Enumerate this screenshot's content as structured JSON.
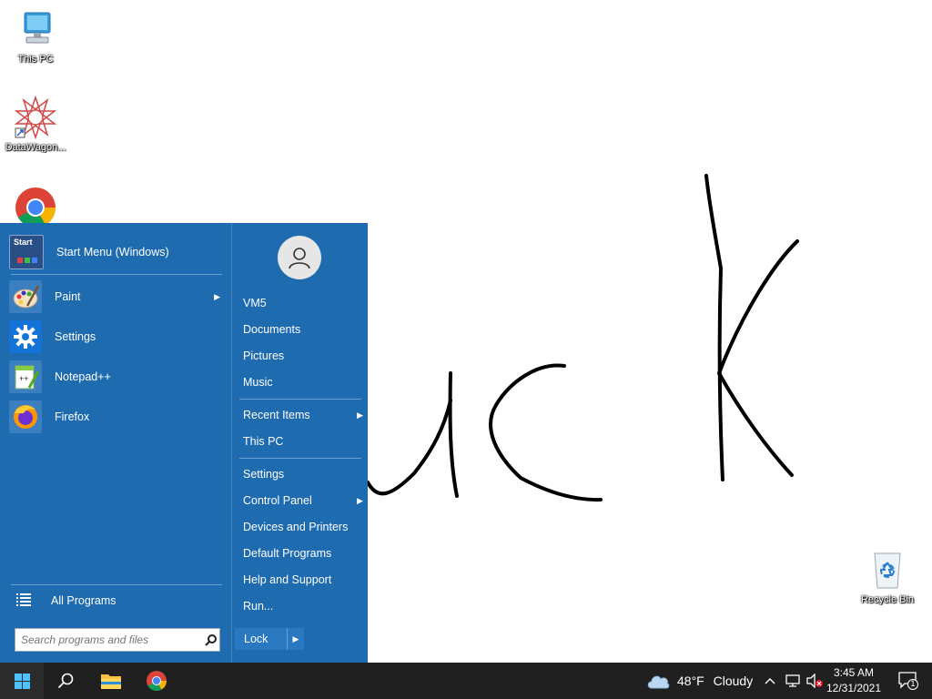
{
  "desktop": {
    "icons": [
      {
        "label": "This PC"
      },
      {
        "label": "DataWagon..."
      },
      {
        "label": ""
      },
      {
        "label": "Recycle Bin"
      }
    ]
  },
  "start_menu": {
    "header": {
      "label": "Start Menu (Windows)",
      "icon_text": "Start"
    },
    "programs": [
      {
        "label": "Paint",
        "has_submenu": true
      },
      {
        "label": "Settings"
      },
      {
        "label": "Notepad++"
      },
      {
        "label": "Firefox"
      }
    ],
    "all_programs": "All Programs",
    "search": {
      "placeholder": "Search programs and files",
      "value": ""
    },
    "right": {
      "user": "VM5",
      "items": [
        {
          "label": "Documents"
        },
        {
          "label": "Pictures"
        },
        {
          "label": "Music"
        },
        {
          "label": "Recent Items",
          "has_submenu": true
        },
        {
          "label": "This PC"
        },
        {
          "label": "Settings"
        },
        {
          "label": "Control Panel",
          "has_submenu": true
        },
        {
          "label": "Devices and Printers"
        },
        {
          "label": "Default Programs"
        },
        {
          "label": "Help and Support"
        },
        {
          "label": "Run..."
        }
      ]
    },
    "lock_label": "Lock"
  },
  "taskbar": {
    "weather": {
      "temp": "48°F",
      "condition": "Cloudy"
    },
    "clock": {
      "time": "3:45 AM",
      "date": "12/31/2021"
    },
    "notification_count": "1"
  },
  "colors": {
    "start_menu_bg": "#1e6bb0",
    "taskbar_bg": "#202020",
    "drawing_ink": "#000000"
  }
}
